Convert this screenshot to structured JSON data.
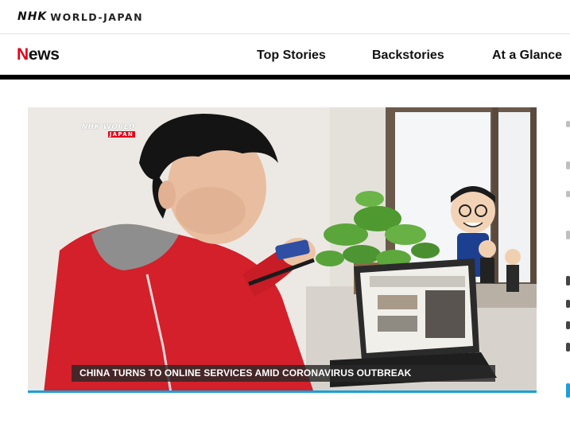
{
  "site": {
    "brand_nhk": "NHK",
    "brand_world_japan": "WORLD-JAPAN"
  },
  "nav": {
    "section_title_first": "N",
    "section_title_rest": "ews",
    "links": [
      "Top Stories",
      "Backstories",
      "At a Glance"
    ]
  },
  "video": {
    "watermark_nhk": "NHK WORLD",
    "watermark_japan": "JAPAN",
    "caption": "CHINA TURNS TO ONLINE SERVICES AMID CORONAVIRUS OUTBREAK",
    "colors": {
      "progress": "#1aa0d8",
      "hoodie": "#d3202b"
    }
  },
  "colors": {
    "brand_red": "#e3001b",
    "rule": "#000000"
  }
}
